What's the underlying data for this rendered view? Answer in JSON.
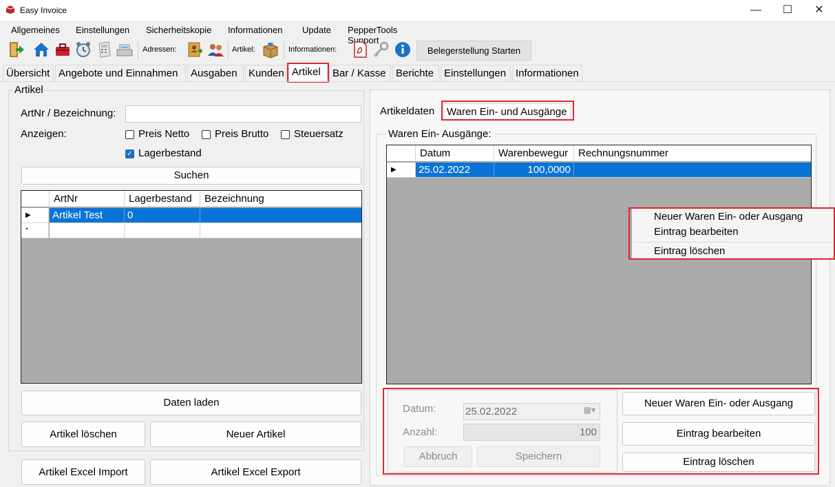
{
  "window": {
    "title": "Easy Invoice",
    "controls": {
      "minimize": "—",
      "maximize": "☐",
      "close": "✕"
    }
  },
  "menu": [
    "Allgemeines",
    "Einstellungen",
    "Sicherheitskopie",
    "Informationen",
    "Update",
    "PepperTools Support"
  ],
  "toolbar": {
    "icons": [
      "exit-icon",
      "home-icon",
      "toolbox-icon",
      "alarm-clock-icon",
      "calculator-icon",
      "cash-register-icon",
      "address-book-icon",
      "contacts-icon",
      "article-box-icon",
      "pdf-icon",
      "key-icon",
      "info-icon"
    ],
    "adressen_label": "Adressen:",
    "artikel_label": "Artikel:",
    "informationen_label": "Informationen:",
    "start_button": "Belegerstellung Starten"
  },
  "tabs": [
    "Übersicht",
    "Angebote und Einnahmen",
    "Ausgaben",
    "Kunden",
    "Artikel",
    "Bar / Kasse",
    "Berichte",
    "Einstellungen",
    "Informationen"
  ],
  "active_tab": "Artikel",
  "left": {
    "group_title": "Artikel",
    "search_label": "ArtNr / Bezeichnung:",
    "search_value": "",
    "anzeigen_label": "Anzeigen:",
    "checkboxes": [
      {
        "label": "Preis Netto",
        "checked": false
      },
      {
        "label": "Preis Brutto",
        "checked": false
      },
      {
        "label": "Steuersatz",
        "checked": false
      },
      {
        "label": "Lagerbestand",
        "checked": true
      }
    ],
    "search_button": "Suchen",
    "grid": {
      "columns": [
        "ArtNr",
        "Lagerbestand",
        "Bezeichnung"
      ],
      "rows": [
        {
          "artnr": "Artikel Test",
          "lagerbestand": "0",
          "bezeichnung": ""
        }
      ],
      "new_row_marker": "*"
    },
    "btn_load": "Daten laden",
    "btn_delete": "Artikel löschen",
    "btn_new": "Neuer Artikel",
    "btn_import": "Artikel Excel Import",
    "btn_export": "Artikel Excel Export"
  },
  "right": {
    "subtabs": [
      "Artikeldaten",
      "Waren Ein- und Ausgänge"
    ],
    "active_subtab": "Waren Ein- und Ausgänge",
    "group_title": "Waren Ein- Ausgänge:",
    "grid": {
      "columns": [
        "Datum",
        "Warenbewegur",
        "Rechnungsnummer"
      ],
      "rows": [
        {
          "datum": "25.02.2022",
          "menge": "100,0000",
          "rechnung": ""
        }
      ]
    },
    "context_menu": [
      "Neuer Waren Ein- oder Ausgang",
      "Eintrag bearbeiten",
      "Eintrag löschen"
    ],
    "form": {
      "datum_label": "Datum:",
      "datum_value": "25.02.2022",
      "anzahl_label": "Anzahl:",
      "anzahl_value": "100",
      "btn_cancel": "Abbruch",
      "btn_save": "Speichern"
    },
    "btn_new": "Neuer Waren Ein- oder Ausgang",
    "btn_edit": "Eintrag bearbeiten",
    "btn_delete": "Eintrag löschen"
  },
  "colors": {
    "highlight": "#e0262f",
    "selection": "#0a74d6"
  }
}
